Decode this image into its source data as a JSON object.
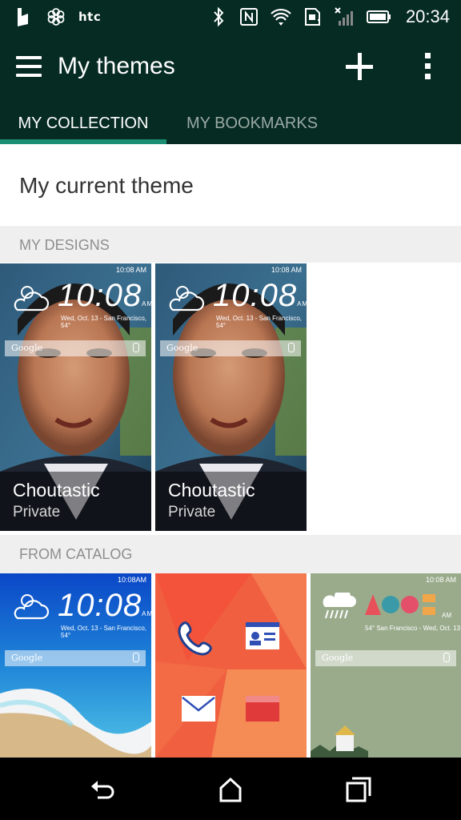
{
  "status_bar": {
    "brand": "htc",
    "time": "20:34"
  },
  "app_bar": {
    "title": "My themes",
    "icons": [
      "menu-icon",
      "add-icon",
      "more-vert-icon"
    ]
  },
  "tabs": [
    {
      "label": "MY COLLECTION",
      "selected": true
    },
    {
      "label": "MY BOOKMARKS",
      "selected": false
    }
  ],
  "current_theme": {
    "label": "My current theme"
  },
  "sections": {
    "my_designs": "MY DESIGNS",
    "from_catalog": "FROM CATALOG"
  },
  "my_designs": [
    {
      "name": "Choutastic",
      "visibility": "Private",
      "clock": "10:08",
      "ampm": "AM",
      "date": "Wed, Oct. 13 - San Francisco, 54°",
      "search": "Google",
      "mini_time": "10:08 AM"
    },
    {
      "name": "Choutastic",
      "visibility": "Private",
      "clock": "10:08",
      "ampm": "AM",
      "date": "Wed, Oct. 13 - San Francisco, 54°",
      "search": "Google",
      "mini_time": "10:08 AM"
    }
  ],
  "catalog": [
    {
      "clock": "10:08",
      "ampm": "AM",
      "date": "Wed, Oct. 13 - San Francisco, 54°",
      "search": "Google",
      "mini_time": "10:08AM"
    },
    {
      "icons": [
        "phone-icon",
        "contact-card-icon",
        "mail-icon",
        "gallery-icon"
      ]
    },
    {
      "mini_time": "10:08 AM",
      "ampm": "AM",
      "date": "54° San Francisco - Wed, Oct. 13",
      "search": "Google"
    }
  ],
  "colors": {
    "primary_dark": "#062b22",
    "accent": "#1b8f73",
    "section_bg": "#efefef"
  }
}
